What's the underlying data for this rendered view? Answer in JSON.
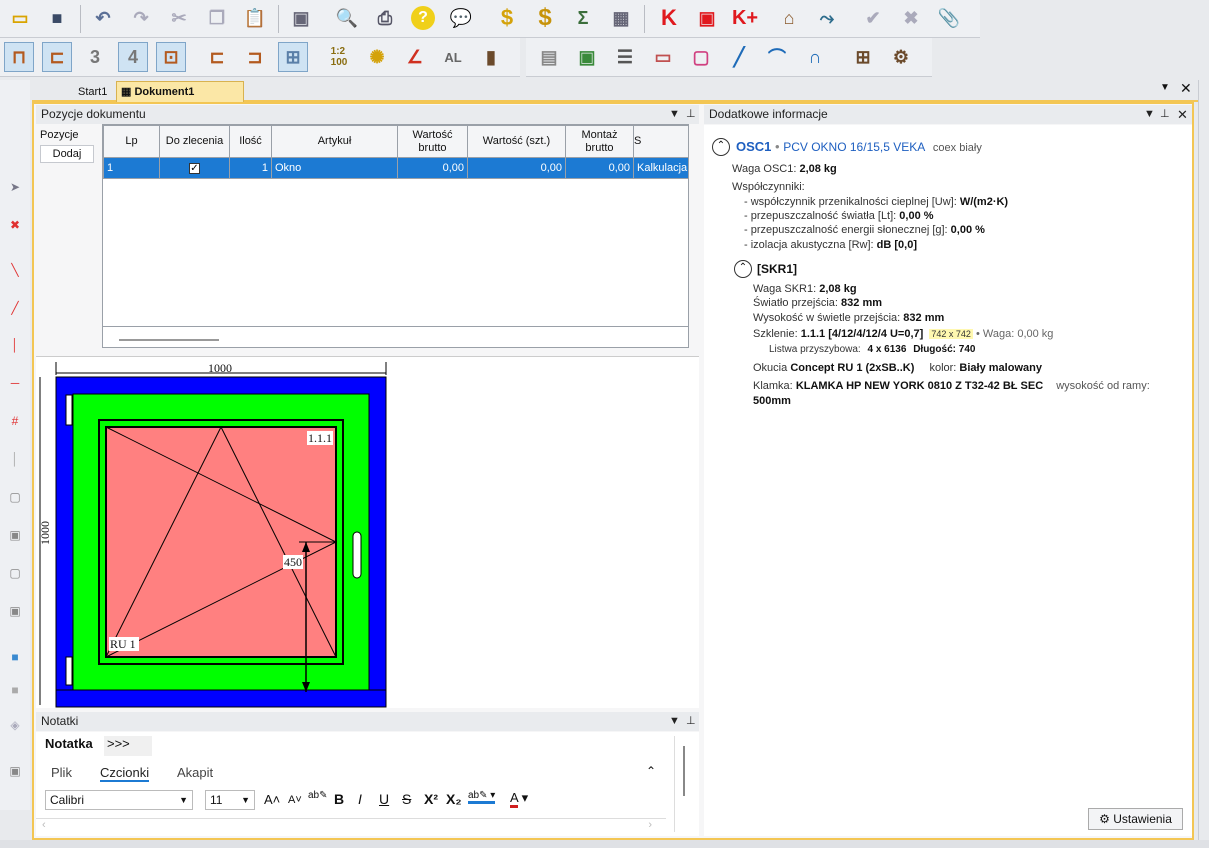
{
  "tabs": [
    "Start1",
    "Dokument1"
  ],
  "positions": {
    "title": "Pozycje dokumentu",
    "left_label": "Pozycje",
    "add_button": "Dodaj",
    "columns": [
      "Lp",
      "Do zlecenia",
      "Ilość",
      "Artykuł",
      "Wartość brutto",
      "Wartość (szt.)",
      "Montaż brutto",
      "S"
    ],
    "rows": [
      {
        "lp": "1",
        "checked": true,
        "qty": "1",
        "article": "Okno",
        "gross": "0,00",
        "unit": "0,00",
        "mount": "0,00",
        "s": "Kalkulacja"
      }
    ]
  },
  "drawing": {
    "width_dim": "1000",
    "height_dim": "1000",
    "glass_label": "1.1.1",
    "sash_label": "RU 1",
    "handle_dim": "450"
  },
  "info": {
    "title": "Dodatkowe informacje",
    "osc_code": "OSC1",
    "osc_name": "PCV OKNO 16/15,5 VEKA",
    "osc_color": "coex biały",
    "weight_label": "Waga OSC1:",
    "weight_value": "2,08 kg",
    "coeffs_label": "Współczynniki:",
    "coeff_uw_label": "- współczynnik przenikalności cieplnej [Uw]:",
    "coeff_uw_value": "W/(m2·K)",
    "coeff_lt_label": "- przepuszczalność światła [Lt]:",
    "coeff_lt_value": "0,00 %",
    "coeff_g_label": "- przepuszczalność energii słonecznej [g]:",
    "coeff_g_value": "0,00 %",
    "coeff_rw_label": "- izolacja akustyczna [Rw]:",
    "coeff_rw_value": "dB [0,0]",
    "skr_code": "[SKR1]",
    "skr_weight_label": "Waga SKR1:",
    "skr_weight_value": "2,08 kg",
    "light_label": "Światło przejścia:",
    "light_value": "832 mm",
    "height_label": "Wysokość w świetle przejścia:",
    "height_value": "832 mm",
    "glass_label": "Szklenie:",
    "glass_value": "1.1.1 [4/12/4/12/4 U=0,7]",
    "glass_size": "742 x 742",
    "glass_weight": "• Waga: 0,00 kg",
    "bead_label": "Listwa przyszybowa:",
    "bead_value": "4 x 6136",
    "bead_len_label": "Długość:",
    "bead_len_value": "740",
    "fitting_label": "Okucia",
    "fitting_value": "Concept RU  1 (2xSB..K)",
    "fitting_color_label": "kolor:",
    "fitting_color_value": "Biały malowany",
    "handle_label": "Klamka:",
    "handle_value": "KLAMKA HP NEW YORK 0810 Z T32-42 BŁ SEC",
    "handle_height_label": "wysokość od ramy:",
    "handle_height_value": "500mm",
    "settings_button": "Ustawienia"
  },
  "notes": {
    "title": "Notatki",
    "tab": "Notatka",
    "more": ">>>",
    "ribbon_tabs": [
      "Plik",
      "Czcionki",
      "Akapit"
    ],
    "font": "Calibri",
    "size": "11"
  },
  "colors": {
    "accent": "#1c7ad3",
    "frame_blue": "#0000ff",
    "sash_green": "#00ff00",
    "glass_pink": "#ff8080",
    "panel_border": "#f3c654"
  }
}
